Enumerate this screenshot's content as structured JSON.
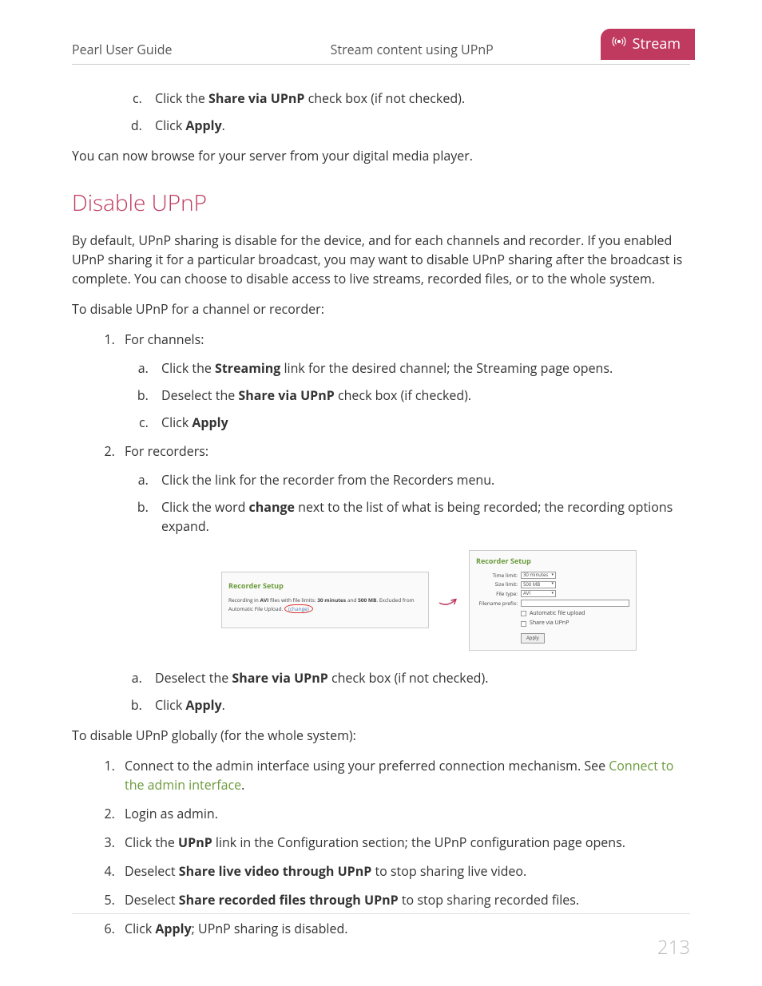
{
  "header": {
    "left": "Pearl User Guide",
    "center": "Stream content using UPnP",
    "tab": "Stream"
  },
  "top_steps": {
    "c": {
      "pre": "Click the ",
      "bold": "Share via UPnP",
      "post": " check box (if not checked)."
    },
    "d": {
      "pre": "Click ",
      "bold": "Apply",
      "post": "."
    }
  },
  "browse_para": "You can now browse for your server from your digital media player.",
  "section_title": "Disable UPnP",
  "intro_para": "By default, UPnP sharing is disable for the device, and for each channels and recorder. If you enabled UPnP sharing it for a particular broadcast, you may want to disable UPnP sharing after the broadcast is complete. You can choose to disable access to live streams, recorded files, or to the whole system.",
  "disable_channel_lead": "To disable UPnP for a channel or recorder:",
  "channels_label": "For channels:",
  "recorders_label": "For recorders:",
  "ch_steps": {
    "a": {
      "pre": "Click the ",
      "bold": "Streaming",
      "post": " link for the desired channel; the Streaming page opens."
    },
    "b": {
      "pre": "Deselect the ",
      "bold": "Share via UPnP",
      "post": " check box (if checked)."
    },
    "c": {
      "pre": "Click ",
      "bold": "Apply",
      "post": ""
    }
  },
  "rec_steps_top": {
    "a": "Click the link for the recorder from the Recorders menu.",
    "b": {
      "pre": "Click the word ",
      "bold": "change",
      "post": " next to the list of what is being recorded; the recording options expand."
    }
  },
  "figure": {
    "panel_title": "Recorder Setup",
    "left_desc_pre": "Recording in ",
    "left_desc_b1": "AVI",
    "left_desc_mid1": " files with file limits: ",
    "left_desc_b2": "30 minutes",
    "left_desc_mid2": " and ",
    "left_desc_b3": "500 MB",
    "left_desc_mid3": ". Excluded from Automatic File Upload. ",
    "change_text": "(change)",
    "labels": {
      "time": "Time limit:",
      "size": "Size limit:",
      "ftype": "File type:",
      "prefix": "Filename prefix:",
      "auto": "Automatic file upload",
      "share": "Share via UPnP",
      "apply": "Apply"
    },
    "values": {
      "time": "30 minutes",
      "size": "500 MB",
      "ftype": "AVI"
    }
  },
  "rec_steps_bottom": {
    "a": {
      "pre": "Deselect the ",
      "bold": "Share via UPnP",
      "post": " check box (if not checked)."
    },
    "b": {
      "pre": "Click ",
      "bold": "Apply",
      "post": "."
    }
  },
  "global_lead": "To disable UPnP globally (for the whole system):",
  "global_steps": {
    "s1": {
      "pre": "Connect to the admin interface using your preferred connection mechanism. See ",
      "link": "Connect to the admin interface",
      "post": "."
    },
    "s2": "Login as admin.",
    "s3": {
      "pre": "Click the ",
      "bold": "UPnP",
      "post": " link in the Configuration section; the UPnP configuration page opens."
    },
    "s4": {
      "pre": "Deselect ",
      "bold": "Share live video through UPnP",
      "post": " to stop sharing live video."
    },
    "s5": {
      "pre": "Deselect ",
      "bold": "Share recorded files through UPnP",
      "post": " to stop sharing recorded files."
    },
    "s6": {
      "pre": "Click ",
      "bold": "Apply",
      "post": "; UPnP sharing is disabled."
    }
  },
  "page_number": "213"
}
